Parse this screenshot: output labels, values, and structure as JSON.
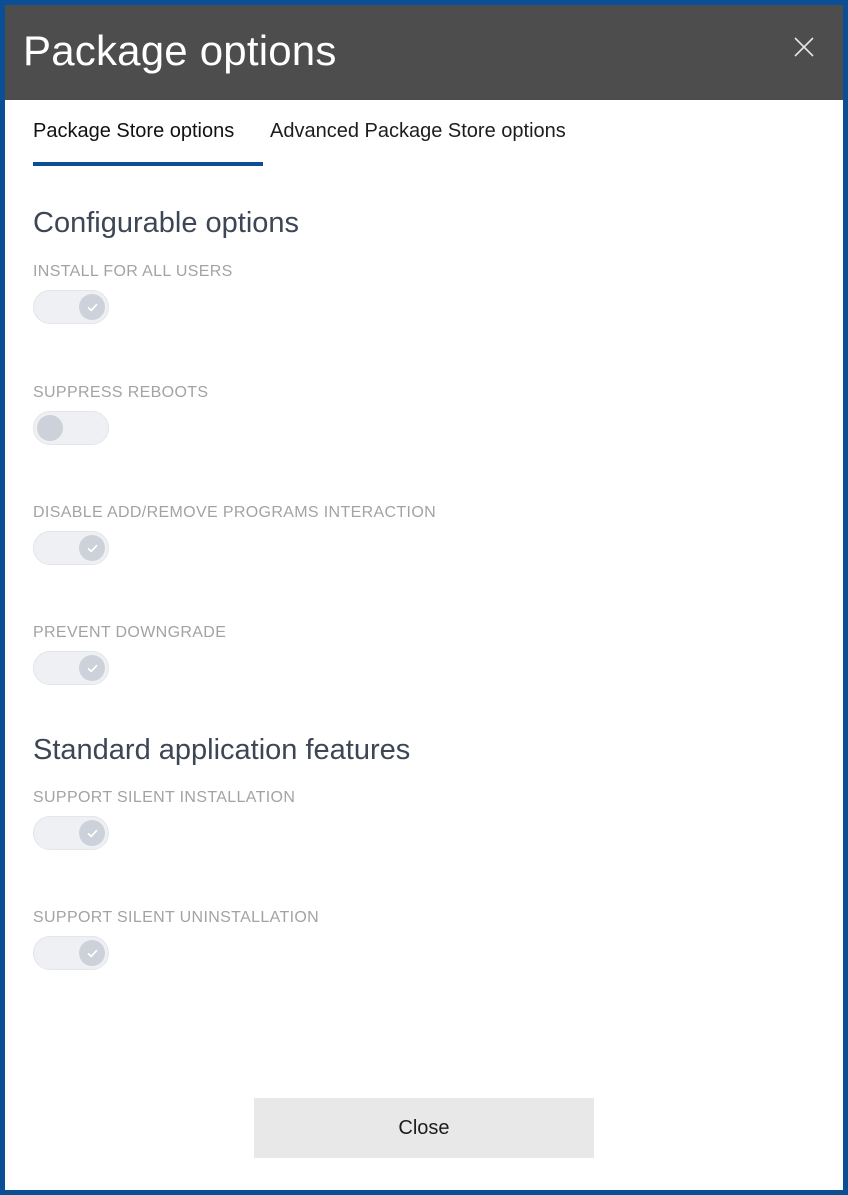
{
  "window": {
    "border_color": "#0a4e96",
    "accent_color": "#0a4e96",
    "titlebar_color": "#4d4d4d"
  },
  "titlebar": {
    "title": "Package options",
    "close_icon": "close-icon"
  },
  "tabs": [
    {
      "label": "Package Store options",
      "active": true
    },
    {
      "label": "Advanced Package Store options",
      "active": false
    }
  ],
  "sections": [
    {
      "heading": "Configurable options",
      "options": [
        {
          "label": "INSTALL FOR ALL USERS",
          "state": "on"
        },
        {
          "label": "SUPPRESS REBOOTS",
          "state": "off"
        },
        {
          "label": "DISABLE ADD/REMOVE PROGRAMS INTERACTION",
          "state": "on"
        },
        {
          "label": "PREVENT DOWNGRADE",
          "state": "on"
        }
      ]
    },
    {
      "heading": "Standard application features",
      "options": [
        {
          "label": "SUPPORT SILENT INSTALLATION",
          "state": "on"
        },
        {
          "label": "SUPPORT SILENT UNINSTALLATION",
          "state": "on"
        }
      ]
    }
  ],
  "footer": {
    "close_label": "Close"
  }
}
